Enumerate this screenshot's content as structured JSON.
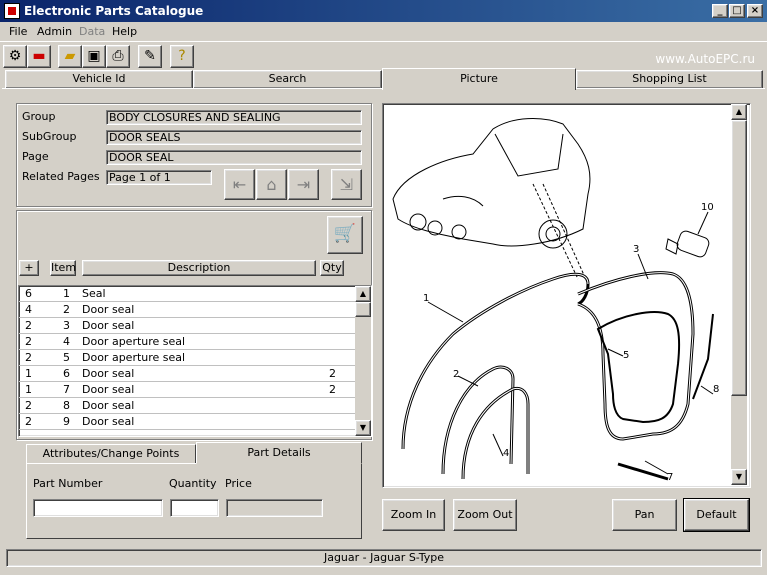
{
  "window": {
    "title": "Electronic Parts Catalogue"
  },
  "menu": {
    "file": "File",
    "admin": "Admin",
    "data": "Data",
    "help": "Help"
  },
  "watermark": "www.AutoEPC.ru",
  "tabs": {
    "vehicle_id": "Vehicle Id",
    "search": "Search",
    "picture": "Picture",
    "shopping_list": "Shopping List"
  },
  "info": {
    "group_label": "Group",
    "group_value": "BODY CLOSURES AND SEALING",
    "subgroup_label": "SubGroup",
    "subgroup_value": "DOOR SEALS",
    "page_label": "Page",
    "page_value": "DOOR SEAL",
    "related_label": "Related Pages",
    "related_value": "Page 1 of 1"
  },
  "columns": {
    "plus": "+",
    "item": "Item",
    "description": "Description",
    "qty": "Qty"
  },
  "rows": [
    {
      "a": "6",
      "item": "1",
      "desc": "Seal",
      "qty": ""
    },
    {
      "a": "4",
      "item": "2",
      "desc": "Door seal",
      "qty": ""
    },
    {
      "a": "2",
      "item": "3",
      "desc": "Door seal",
      "qty": ""
    },
    {
      "a": "2",
      "item": "4",
      "desc": "Door aperture seal",
      "qty": ""
    },
    {
      "a": "2",
      "item": "5",
      "desc": "Door aperture seal",
      "qty": ""
    },
    {
      "a": "1",
      "item": "6",
      "desc": "Door seal",
      "qty": "2"
    },
    {
      "a": "1",
      "item": "7",
      "desc": "Door seal",
      "qty": "2"
    },
    {
      "a": "2",
      "item": "8",
      "desc": "Door seal",
      "qty": ""
    },
    {
      "a": "2",
      "item": "9",
      "desc": "Door seal",
      "qty": ""
    }
  ],
  "subtabs": {
    "attributes": "Attributes/Change Points",
    "part_details": "Part Details"
  },
  "details": {
    "part_number": "Part Number",
    "quantity": "Quantity",
    "price": "Price"
  },
  "buttons": {
    "zoom_in": "Zoom In",
    "zoom_out": "Zoom Out",
    "pan": "Pan",
    "default": "Default"
  },
  "callouts": [
    "1",
    "2",
    "3",
    "4",
    "5",
    "7",
    "8",
    "10"
  ],
  "status": "Jaguar - Jaguar S-Type"
}
